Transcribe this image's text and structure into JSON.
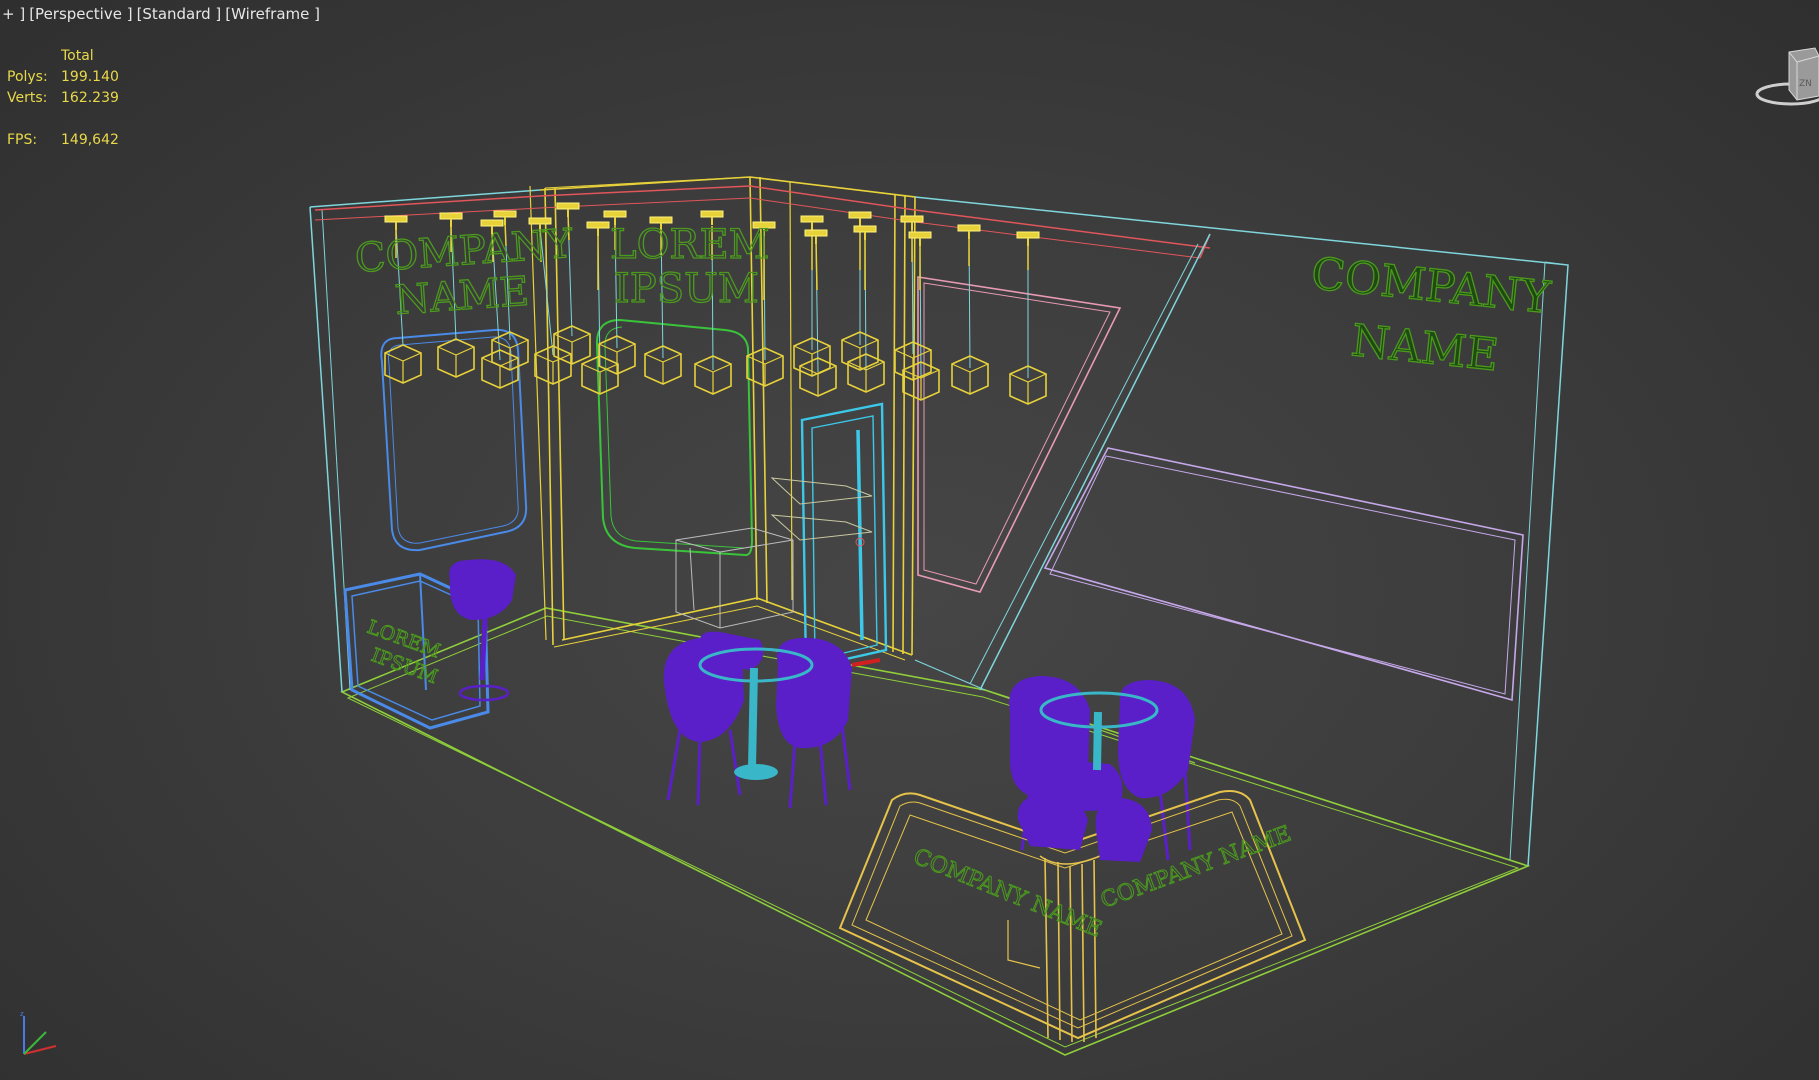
{
  "viewport": {
    "label_parts": [
      "+ ]",
      "[Perspective ]",
      "[Standard ]",
      "[Wireframe ]"
    ]
  },
  "stats": {
    "header": "Total",
    "polys_label": "Polys:",
    "polys_value": "199.140",
    "verts_label": "Verts:",
    "verts_value": "162.239",
    "fps_label": "FPS:",
    "fps_value": "149,642"
  },
  "scene": {
    "left_wall_text": [
      "COMPANY",
      "NAME"
    ],
    "center_wall_text": [
      "LOREM",
      "IPSUM"
    ],
    "right_wall_text": [
      "COMPANY",
      "NAME"
    ],
    "reception_text": [
      "LOREM",
      "IPSUM"
    ],
    "counter_left_text": "COMPANY NAME",
    "counter_right_text": "COMPANY NAME"
  },
  "viewcube": {
    "label": "ZN"
  },
  "colors": {
    "background": "#3d3d3d",
    "hud_text": "#e8d84a",
    "label_text": "#e6e6e6",
    "floor_edges": "#8fcf3a",
    "wall_edges": "#7fd6dc",
    "lamps": "#e8d23a",
    "logo_text": "#4b9a1e",
    "chairs": "#5a1fc8",
    "table_top": "#39b6c8",
    "counter": "#e6c34a",
    "door": "#3cc8e8",
    "pink_panel": "#e89ab4",
    "lavender_panel": "#c6a8ea",
    "blue_panel": "#4a8ae8",
    "green_panel": "#3ac43a"
  }
}
